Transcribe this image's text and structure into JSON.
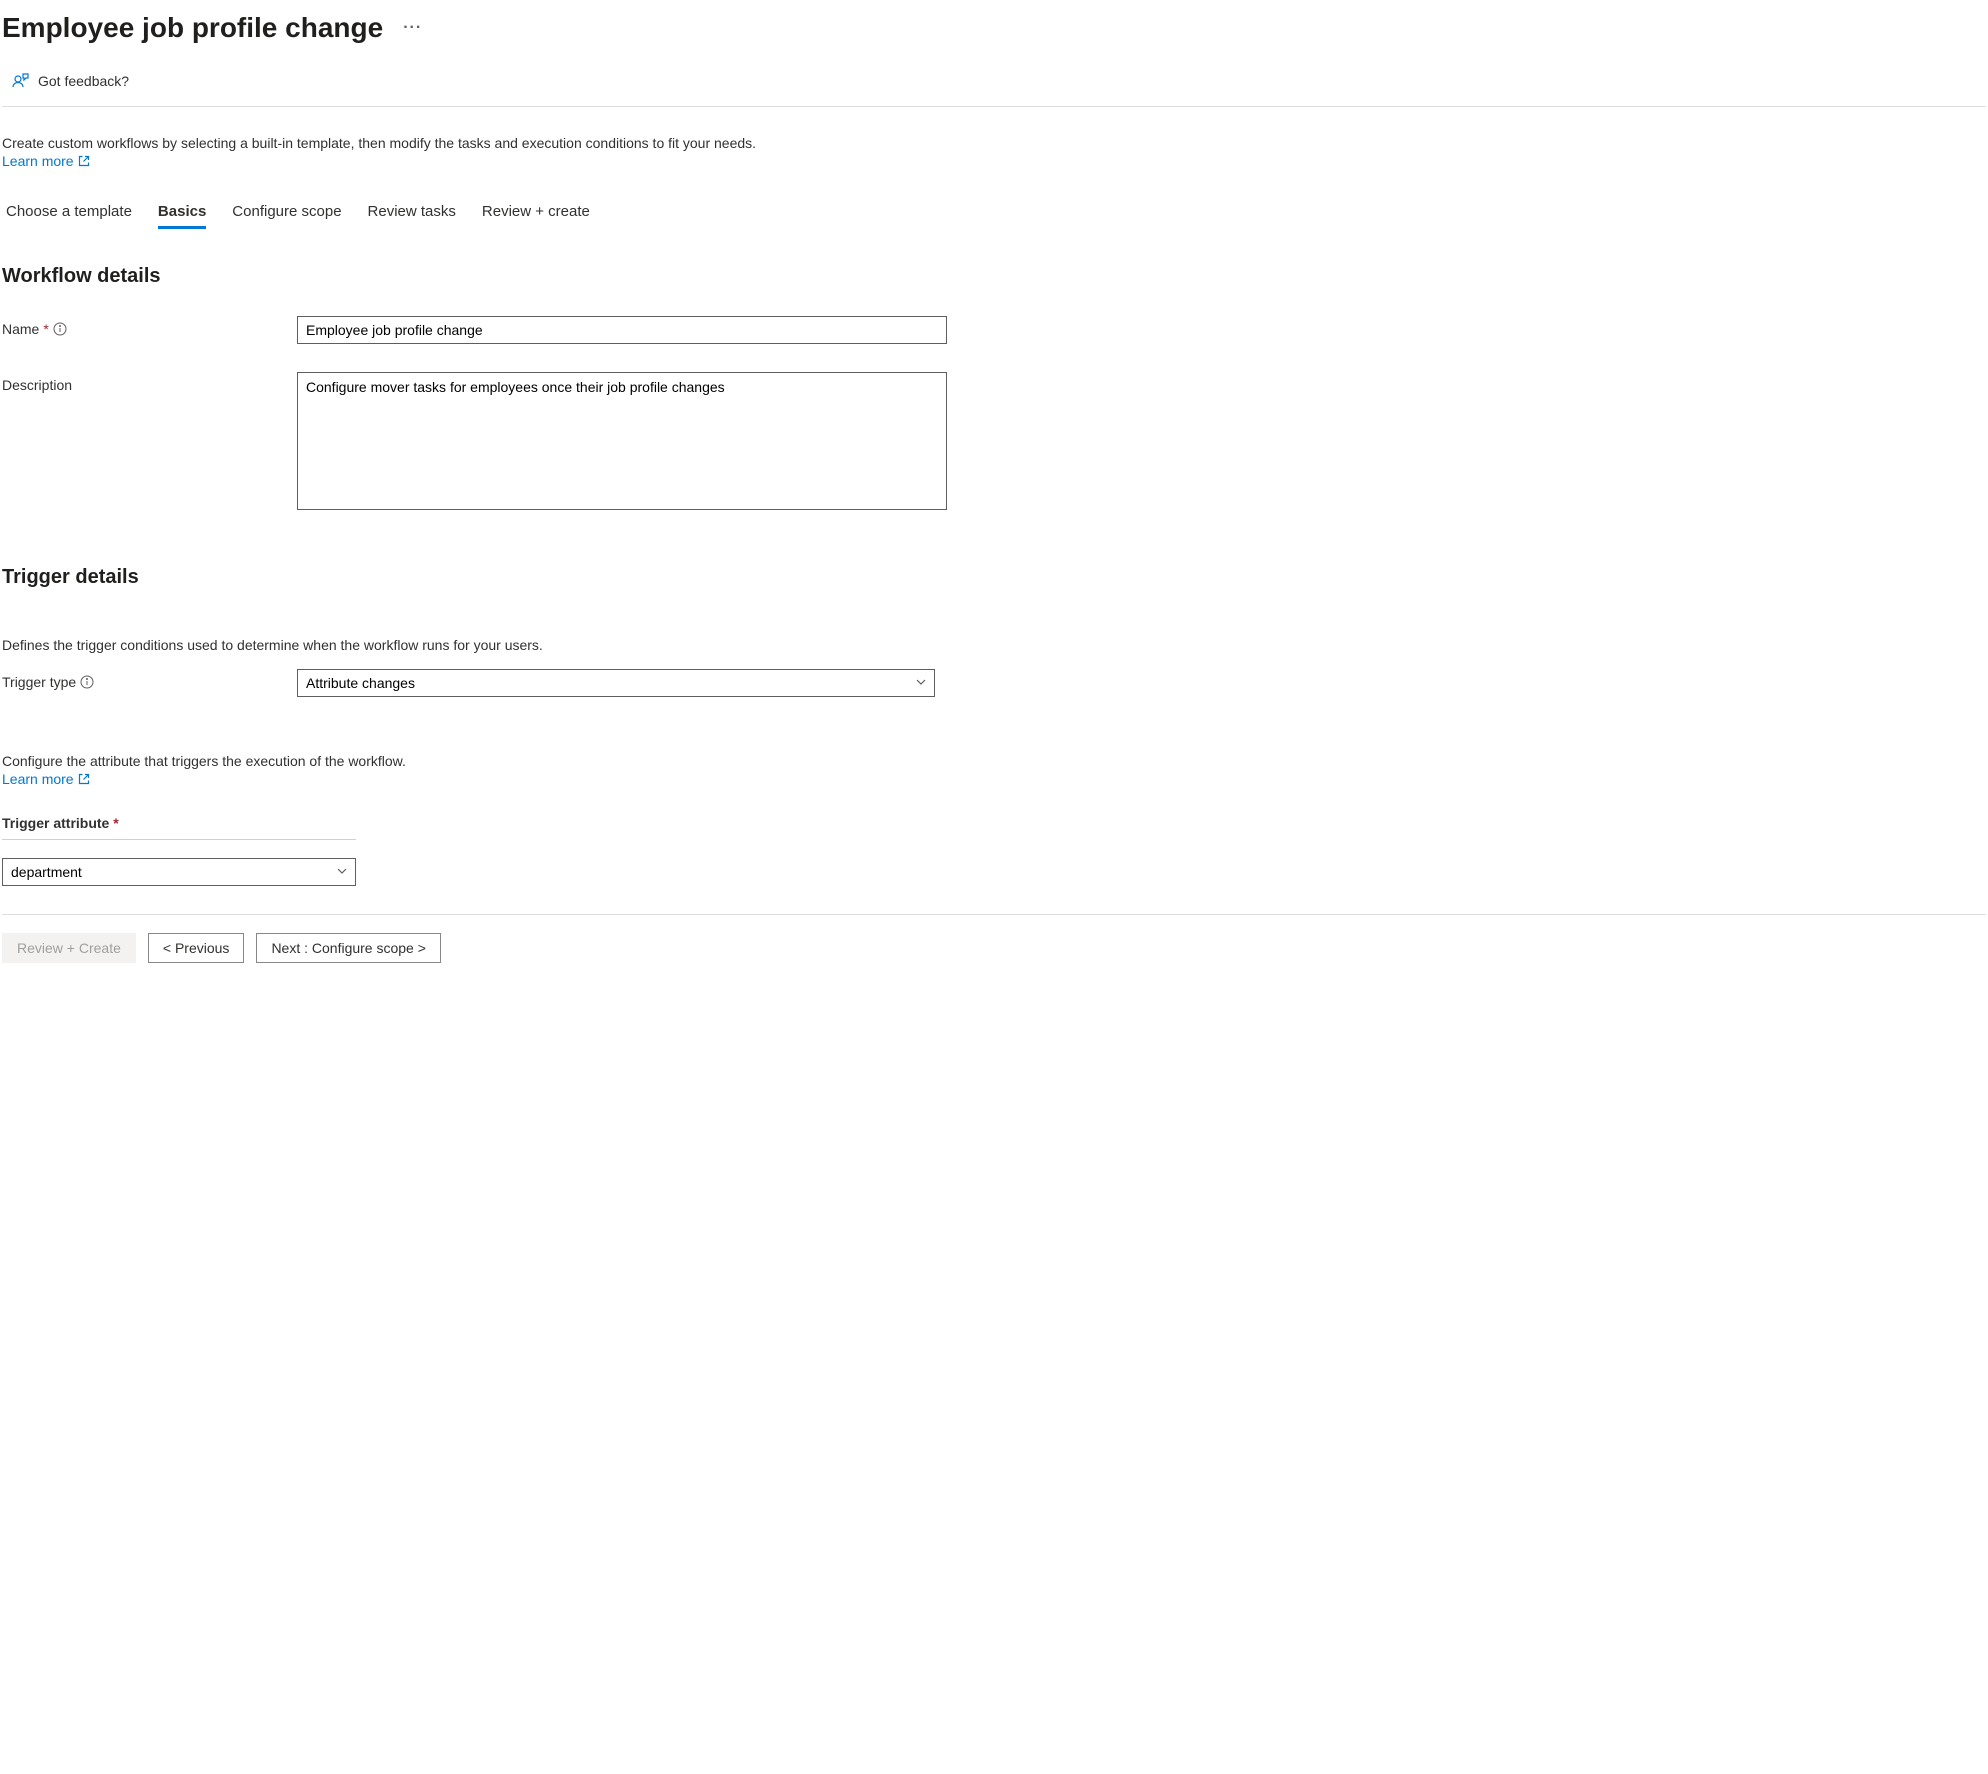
{
  "header": {
    "title": "Employee job profile change"
  },
  "toolbar": {
    "feedback_label": "Got feedback?"
  },
  "intro": {
    "text": "Create custom workflows by selecting a built-in template, then modify the tasks and execution conditions to fit your needs.",
    "learn_more": "Learn more"
  },
  "tabs": [
    {
      "label": "Choose a template",
      "active": false
    },
    {
      "label": "Basics",
      "active": true
    },
    {
      "label": "Configure scope",
      "active": false
    },
    {
      "label": "Review tasks",
      "active": false
    },
    {
      "label": "Review + create",
      "active": false
    }
  ],
  "sections": {
    "workflow_details": {
      "title": "Workflow details",
      "name_label": "Name",
      "name_value": "Employee job profile change",
      "description_label": "Description",
      "description_value": "Configure mover tasks for employees once their job profile changes"
    },
    "trigger_details": {
      "title": "Trigger details",
      "helper1": "Defines the trigger conditions used to determine when the workflow runs for your users.",
      "trigger_type_label": "Trigger type",
      "trigger_type_value": "Attribute changes",
      "helper2": "Configure the attribute that triggers the execution of the workflow.",
      "learn_more": "Learn more",
      "trigger_attribute_label": "Trigger attribute",
      "trigger_attribute_value": "department"
    }
  },
  "footer": {
    "review_create": "Review + Create",
    "previous": "< Previous",
    "next": "Next : Configure scope >"
  }
}
